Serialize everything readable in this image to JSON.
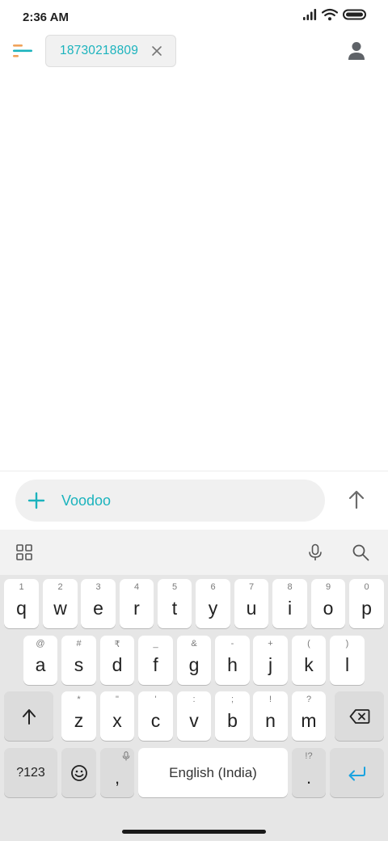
{
  "status_bar": {
    "time": "2:36 AM",
    "icons": [
      "signal-icon",
      "wifi-icon",
      "battery-icon"
    ]
  },
  "header": {
    "menu_icon": "menu-icon",
    "recipient": "18730218809",
    "contact_icon": "person-icon"
  },
  "compose": {
    "text": "Voodoo",
    "attach_icon": "plus-icon",
    "send_icon": "arrow-up-icon"
  },
  "keyboard": {
    "toolbar_icons": [
      "grid-icon",
      "microphone-icon",
      "search-icon"
    ],
    "row1": [
      {
        "hint": "1",
        "key": "q"
      },
      {
        "hint": "2",
        "key": "w"
      },
      {
        "hint": "3",
        "key": "e"
      },
      {
        "hint": "4",
        "key": "r"
      },
      {
        "hint": "5",
        "key": "t"
      },
      {
        "hint": "6",
        "key": "y"
      },
      {
        "hint": "7",
        "key": "u"
      },
      {
        "hint": "8",
        "key": "i"
      },
      {
        "hint": "9",
        "key": "o"
      },
      {
        "hint": "0",
        "key": "p"
      }
    ],
    "row2": [
      {
        "hint": "@",
        "key": "a"
      },
      {
        "hint": "#",
        "key": "s"
      },
      {
        "hint": "₹",
        "key": "d"
      },
      {
        "hint": "_",
        "key": "f"
      },
      {
        "hint": "&",
        "key": "g"
      },
      {
        "hint": "-",
        "key": "h"
      },
      {
        "hint": "+",
        "key": "j"
      },
      {
        "hint": "(",
        "key": "k"
      },
      {
        "hint": ")",
        "key": "l"
      }
    ],
    "row3": [
      {
        "hint": "*",
        "key": "z"
      },
      {
        "hint": "\"",
        "key": "x"
      },
      {
        "hint": "'",
        "key": "c"
      },
      {
        "hint": ":",
        "key": "v"
      },
      {
        "hint": ";",
        "key": "b"
      },
      {
        "hint": "!",
        "key": "n"
      },
      {
        "hint": "?",
        "key": "m"
      }
    ],
    "symbols_label": "?123",
    "comma_label": ",",
    "space_label": "English (India)",
    "period_label": ".",
    "period_hint": "!?",
    "accent_color": "#1aa3e0",
    "brand_color": "#1bb3bd"
  }
}
